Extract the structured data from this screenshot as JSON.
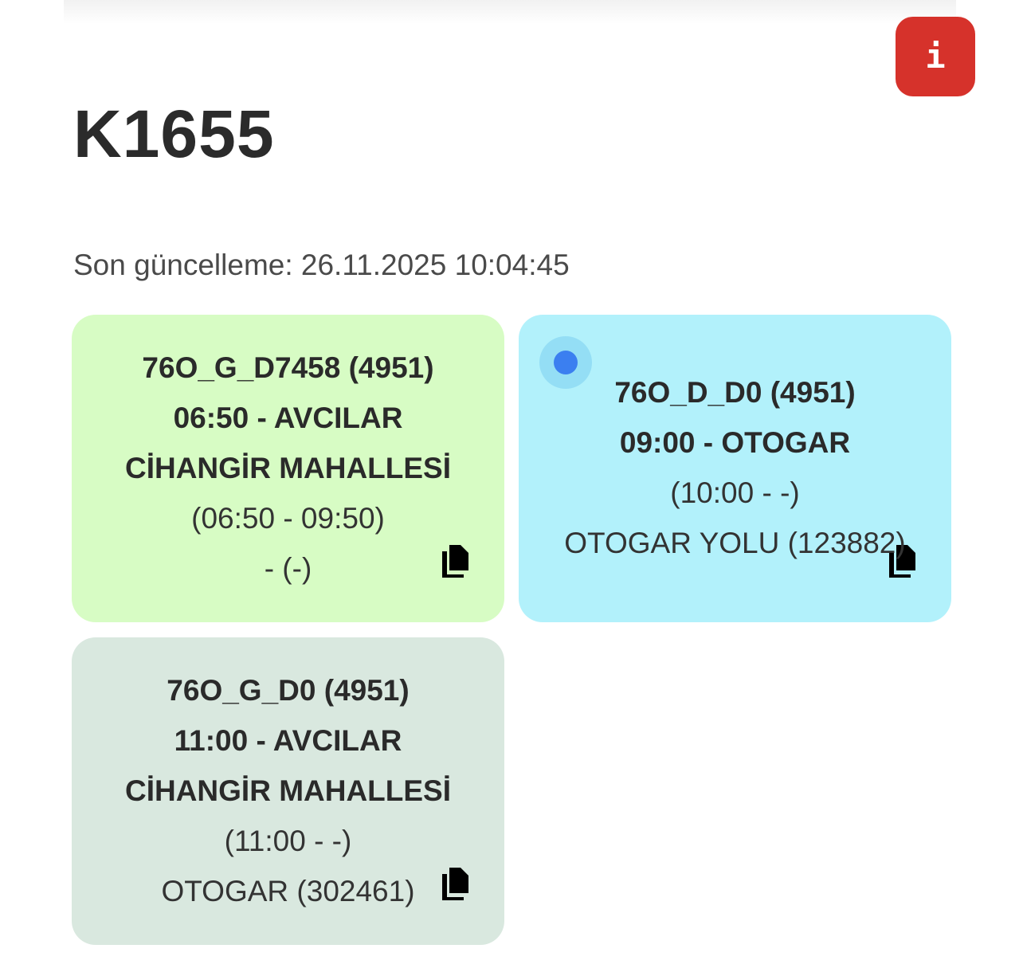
{
  "header": {
    "vehicle_id": "K1655",
    "info_icon": "i",
    "info_button_color": "#d6322b"
  },
  "last_update": "Son güncelleme: 26.11.2025 10:04:45",
  "trips": [
    {
      "background": "#d7fcc4",
      "route": "76O_G_D7458 (4951)",
      "departure": "06:50 - AVCILAR",
      "destination": "CİHANGİR MAHALLESİ",
      "times": "(06:50 - 09:50)",
      "stop": "- (-)",
      "live": false,
      "copy_icon": "copy-icon"
    },
    {
      "background": "#b2f1fb",
      "route": "76O_D_D0 (4951)",
      "departure": "09:00 - OTOGAR",
      "destination": "",
      "times": "(10:00 - -)",
      "stop": "OTOGAR YOLU (123882)",
      "live": true,
      "copy_icon": "copy-icon"
    },
    {
      "background": "#d9e8df",
      "route": "76O_G_D0 (4951)",
      "departure": "11:00 - AVCILAR",
      "destination": "CİHANGİR MAHALLESİ",
      "times": "(11:00 - -)",
      "stop": "OTOGAR (302461)",
      "live": false,
      "copy_icon": "copy-icon"
    }
  ]
}
